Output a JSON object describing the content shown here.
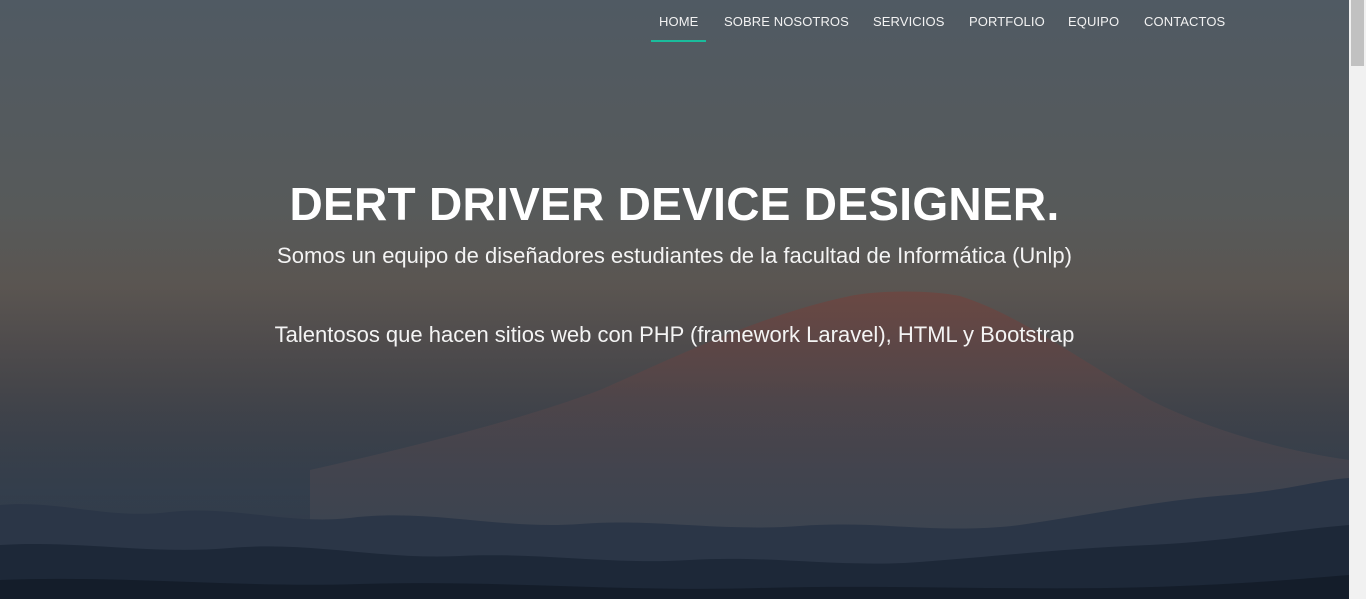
{
  "nav": {
    "items": [
      {
        "label": "HOME",
        "active": true
      },
      {
        "label": "SOBRE NOSOTROS",
        "active": false
      },
      {
        "label": "SERVICIOS",
        "active": false
      },
      {
        "label": "PORTFOLIO",
        "active": false
      },
      {
        "label": "EQUIPO",
        "active": false
      },
      {
        "label": "CONTACTOS",
        "active": false
      }
    ],
    "active_color": "#1abc9c"
  },
  "hero": {
    "title": "DERT DRIVER DEVICE DESIGNER.",
    "subtitle_1": "Somos un equipo de diseñadores estudiantes de la facultad de Informática (Unlp)",
    "subtitle_2": "Talentosos que hacen sitios web con PHP (framework Laravel), HTML y Bootstrap",
    "background_image": "mountain-landscape-photo"
  }
}
